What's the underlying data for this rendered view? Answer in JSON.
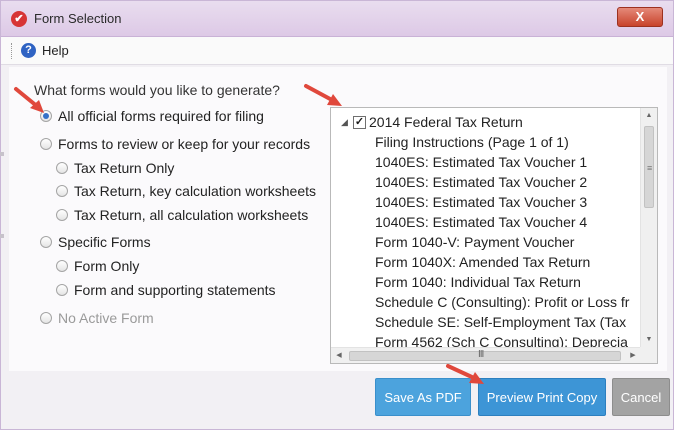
{
  "window": {
    "title": "Form Selection",
    "close_label": "X"
  },
  "menu": {
    "help_label": "Help"
  },
  "question": "What forms would you like to generate?",
  "options": [
    {
      "label": "All official forms required for filing",
      "checked": true
    },
    {
      "label": "Forms to review or keep for your records",
      "checked": false
    },
    {
      "label": "Tax Return Only",
      "checked": false
    },
    {
      "label": "Tax Return, key calculation worksheets",
      "checked": false
    },
    {
      "label": "Tax Return, all calculation worksheets",
      "checked": false
    },
    {
      "label": "Specific Forms",
      "checked": false
    },
    {
      "label": "Form Only",
      "checked": false
    },
    {
      "label": "Form and supporting statements",
      "checked": false
    },
    {
      "label": "No Active Form",
      "checked": false,
      "disabled": true
    }
  ],
  "tree": {
    "root_label": "2014 Federal Tax Return",
    "root_checked": true,
    "items": [
      "Filing Instructions (Page 1 of 1)",
      "1040ES: Estimated Tax Voucher 1",
      "1040ES: Estimated Tax Voucher 2",
      "1040ES: Estimated Tax Voucher 3",
      "1040ES: Estimated Tax Voucher 4",
      "Form 1040-V: Payment Voucher",
      "Form 1040X: Amended Tax Return",
      "Form 1040: Individual Tax Return",
      "Schedule C (Consulting): Profit or Loss fr",
      "Schedule SE: Self-Employment Tax (Tax",
      "Form 4562 (Sch C Consulting): Deprecia"
    ]
  },
  "buttons": {
    "save_pdf": "Save As PDF",
    "preview": "Preview Print Copy",
    "cancel": "Cancel"
  },
  "colors": {
    "annotation_arrow": "#e0483c",
    "primary_button": "#3d95d6",
    "cancel_button": "#a3a3a3"
  }
}
